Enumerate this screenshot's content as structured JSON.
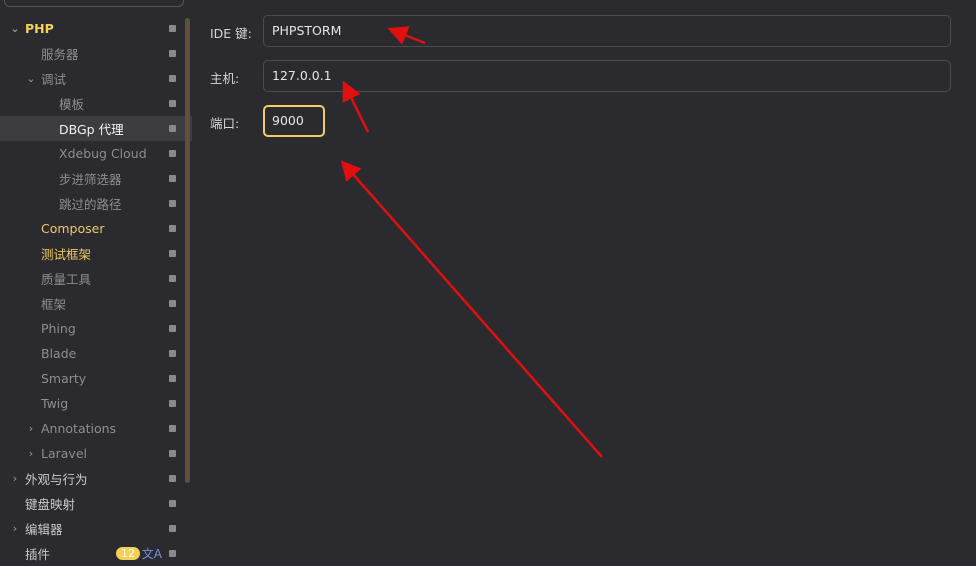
{
  "sidebar": {
    "items": [
      {
        "label": "PHP",
        "level": 0,
        "chevron": "down"
      },
      {
        "label": "服务器",
        "level": 1
      },
      {
        "label": "调试",
        "level": 1,
        "chevron": "down"
      },
      {
        "label": "模板",
        "level": 2
      },
      {
        "label": "DBGp 代理",
        "level": 2,
        "selected": true
      },
      {
        "label": "Xdebug Cloud",
        "level": 2
      },
      {
        "label": "步进筛选器",
        "level": 2
      },
      {
        "label": "跳过的路径",
        "level": 2
      },
      {
        "label": "Composer",
        "level": 1
      },
      {
        "label": "测试框架",
        "level": 1
      },
      {
        "label": "质量工具",
        "level": 1
      },
      {
        "label": "框架",
        "level": 1
      },
      {
        "label": "Phing",
        "level": 1
      },
      {
        "label": "Blade",
        "level": 1
      },
      {
        "label": "Smarty",
        "level": 1
      },
      {
        "label": "Twig",
        "level": 1
      },
      {
        "label": "Annotations",
        "level": 1,
        "chevron": "right"
      },
      {
        "label": "Laravel",
        "level": 1,
        "chevron": "right"
      },
      {
        "label": "外观与行为",
        "level": 0,
        "chevron": "right"
      },
      {
        "label": "键盘映射",
        "level": 0
      },
      {
        "label": "编辑器",
        "level": 0,
        "chevron": "right"
      },
      {
        "label": "插件",
        "level": 0,
        "badge": "12"
      }
    ]
  },
  "form": {
    "ide_key_label": "IDE 键:",
    "ide_key_value": "PHPSTORM",
    "host_label": "主机:",
    "host_value": "127.0.0.1",
    "port_label": "端口:",
    "port_value": "9000"
  },
  "colors": {
    "accent": "#f1cd6a",
    "arrow": "#e01010"
  }
}
